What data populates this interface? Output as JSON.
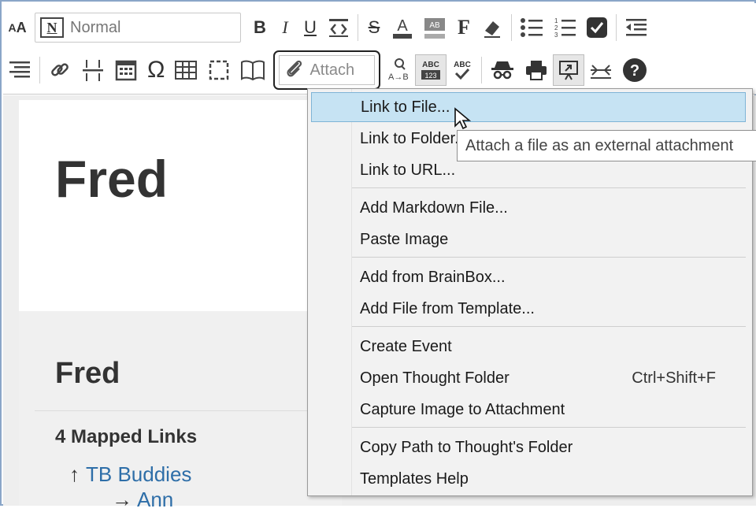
{
  "toolbar": {
    "style_value": "Normal",
    "attach_label": "Attach"
  },
  "document": {
    "title": "Fred",
    "subtitle": "Fred",
    "mapped_links_heading": "4 Mapped Links",
    "links": [
      {
        "arrow": "↑",
        "label": "TB Buddies"
      },
      {
        "arrow": "→",
        "label": "Ann"
      }
    ]
  },
  "menu": {
    "items": [
      {
        "label": "Link to File...",
        "highlighted": true
      },
      {
        "label": "Link to Folder..."
      },
      {
        "label": "Link to URL..."
      },
      {
        "label": "Add Markdown File..."
      },
      {
        "label": "Paste Image"
      },
      {
        "label": "Add from BrainBox..."
      },
      {
        "label": "Add File from Template..."
      },
      {
        "label": "Create Event"
      },
      {
        "label": "Open Thought Folder",
        "shortcut": "Ctrl+Shift+F"
      },
      {
        "label": "Capture Image to Attachment"
      },
      {
        "label": "Copy Path to Thought's Folder"
      },
      {
        "label": "Templates Help"
      }
    ]
  },
  "tooltip": "Attach a file as an external attachment",
  "colors": {
    "highlight": "#c6e3f3",
    "link": "#2e6ea8",
    "frame_border": "#8aa6c8"
  }
}
